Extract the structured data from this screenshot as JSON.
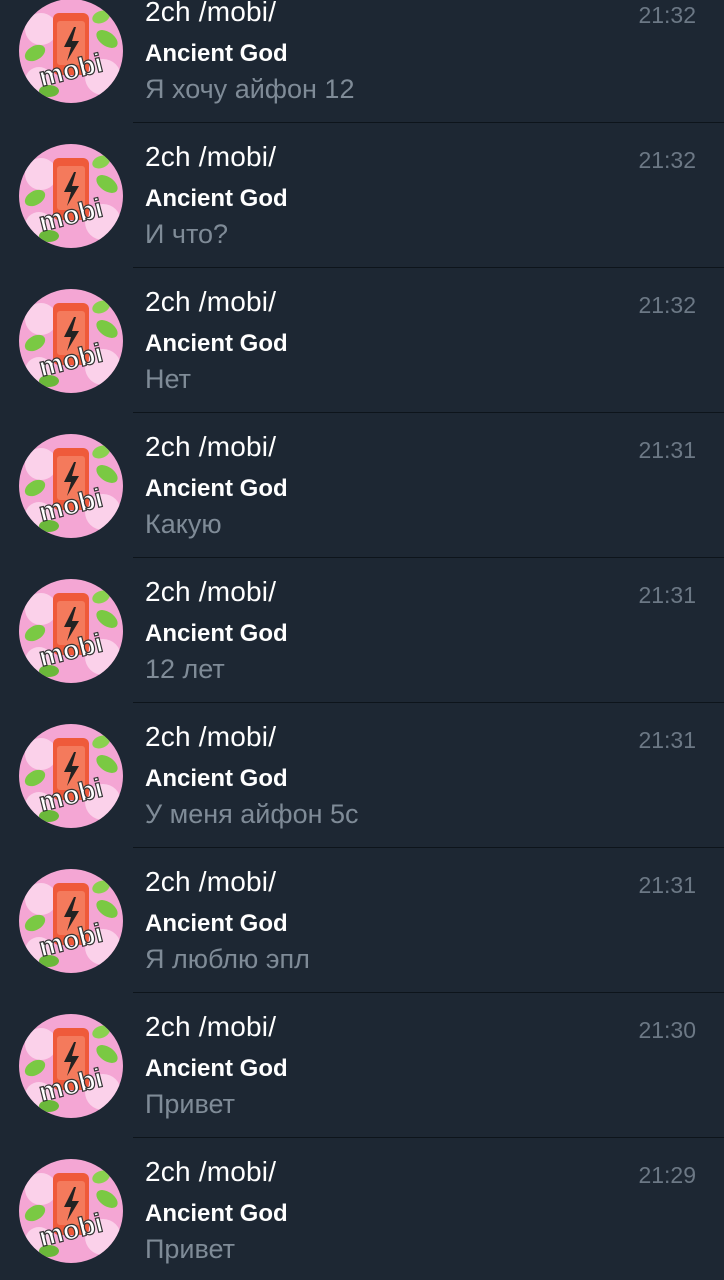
{
  "avatar_label": "mobi",
  "chats": [
    {
      "title": "2ch /mobi/",
      "sender": "Ancient God",
      "message": "Я хочу айфон 12",
      "time": "21:32"
    },
    {
      "title": "2ch /mobi/",
      "sender": "Ancient God",
      "message": "И что?",
      "time": "21:32"
    },
    {
      "title": "2ch /mobi/",
      "sender": "Ancient God",
      "message": "Нет",
      "time": "21:32"
    },
    {
      "title": "2ch /mobi/",
      "sender": "Ancient God",
      "message": "Какую",
      "time": "21:31"
    },
    {
      "title": "2ch /mobi/",
      "sender": "Ancient God",
      "message": "12 лет",
      "time": "21:31"
    },
    {
      "title": "2ch /mobi/",
      "sender": "Ancient God",
      "message": "У меня айфон 5с",
      "time": "21:31"
    },
    {
      "title": "2ch /mobi/",
      "sender": "Ancient God",
      "message": "Я люблю эпл",
      "time": "21:31"
    },
    {
      "title": "2ch /mobi/",
      "sender": "Ancient God",
      "message": "Привет",
      "time": "21:30"
    },
    {
      "title": "2ch /mobi/",
      "sender": "Ancient God",
      "message": "Привет",
      "time": "21:29"
    }
  ],
  "colors": {
    "background": "#1d2733",
    "title": "#ffffff",
    "message": "#7f8b97",
    "time": "#6c7885",
    "avatar_pink": "#f4a6d4",
    "avatar_green": "#7ac943",
    "avatar_phone": "#ef5a3a"
  }
}
